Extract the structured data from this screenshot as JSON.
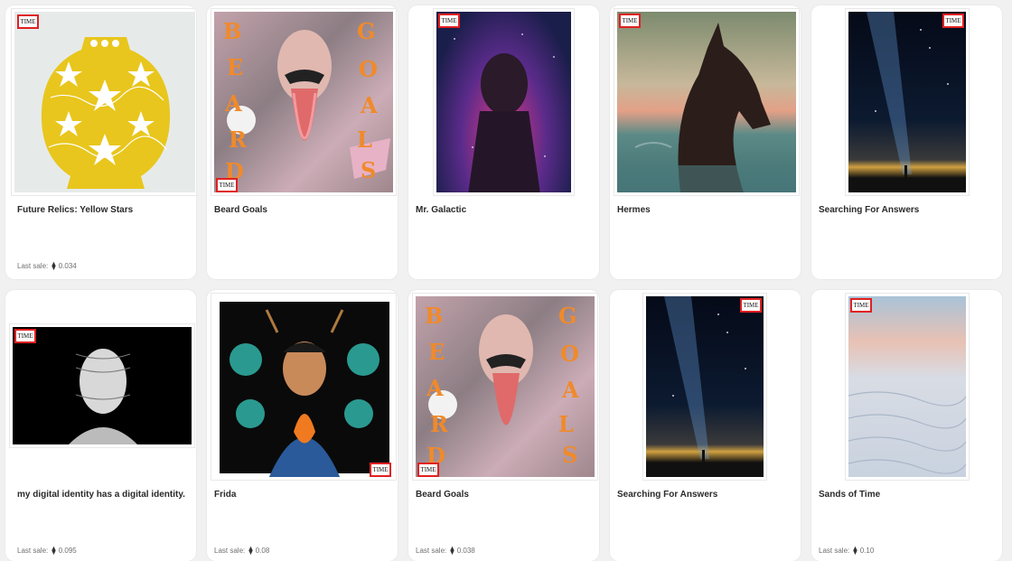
{
  "badge": "TIME",
  "sale_label": "Last sale:",
  "eth_icon": "ethereum-icon",
  "row1": [
    {
      "title": "Future Relics: Yellow Stars",
      "price": "0.034"
    },
    {
      "title": "Beard Goals",
      "price": ""
    },
    {
      "title": "Mr. Galactic",
      "price": ""
    },
    {
      "title": "Hermes",
      "price": ""
    },
    {
      "title": "Searching For Answers",
      "price": ""
    }
  ],
  "row2": [
    {
      "title": "my digital identity has a digital identity.",
      "price": "0.095"
    },
    {
      "title": "Frida",
      "price": "0.08"
    },
    {
      "title": "Beard Goals",
      "price": "0.038"
    },
    {
      "title": "Searching For Answers",
      "price": ""
    },
    {
      "title": "Sands of Time",
      "price": "0.10"
    }
  ]
}
